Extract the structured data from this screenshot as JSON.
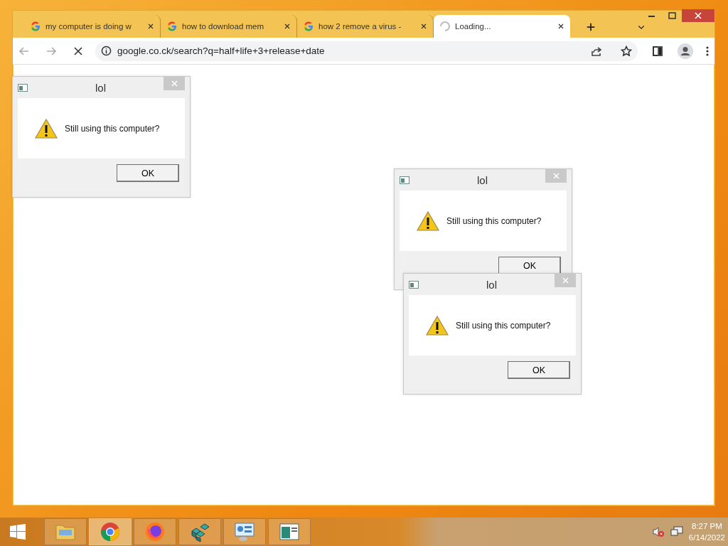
{
  "browser": {
    "tabs": [
      {
        "title": "my computer is doing w",
        "selected": false,
        "loading": false
      },
      {
        "title": "how to download mem",
        "selected": false,
        "loading": false
      },
      {
        "title": "how 2 remove a virus -",
        "selected": false,
        "loading": false
      },
      {
        "title": "Loading...",
        "selected": true,
        "loading": true
      }
    ],
    "address": "google.co.ck/search?q=half+life+3+release+date",
    "loading": true
  },
  "dialogs": [
    {
      "title": "lol",
      "message": "Still using this computer?",
      "button": "OK"
    },
    {
      "title": "lol",
      "message": "Still using this computer?",
      "button": "OK"
    },
    {
      "title": "lol",
      "message": "Still using this computer?",
      "button": "OK"
    }
  ],
  "taskbar": {
    "apps": [
      {
        "kind": "folder",
        "selected": false
      },
      {
        "kind": "chrome",
        "selected": true
      },
      {
        "kind": "firefox",
        "selected": false
      },
      {
        "kind": "cubes",
        "selected": false
      },
      {
        "kind": "panel",
        "selected": false
      },
      {
        "kind": "document",
        "selected": false
      }
    ],
    "time": "8:27 PM",
    "date": "6/14/2022"
  }
}
